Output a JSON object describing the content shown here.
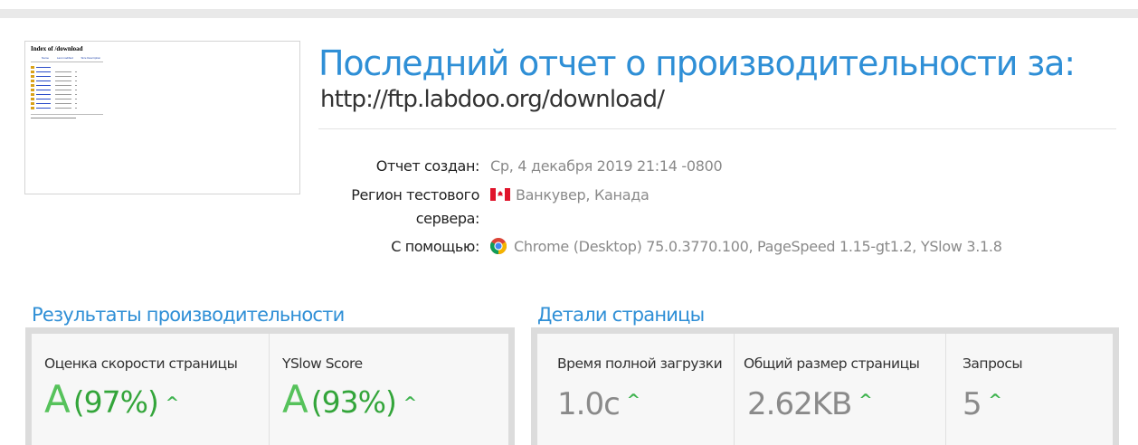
{
  "thumbnail": {
    "title": "Index of /download",
    "headers": [
      "Name",
      "Last modified",
      "Size Description"
    ]
  },
  "report": {
    "title": "Последний отчет о производительности за:",
    "url": "http://ftp.labdoo.org/download/"
  },
  "meta": {
    "created_label": "Отчет создан:",
    "created_value": "Ср, 4 декабря 2019 21:14 -0800",
    "region_label_line1": "Регион тестового",
    "region_label_line2": "сервера:",
    "region_value": "Ванкувер, Канада",
    "region_flag_icon": "canada-flag-icon",
    "using_label": "С помощью:",
    "using_value": "Chrome (Desktop) 75.0.3770.100, PageSpeed 1.15-gt1.2, YSlow 3.1.8",
    "using_icon": "chrome-icon"
  },
  "performance": {
    "section_title": "Результаты производительности",
    "pagespeed": {
      "label": "Оценка скорости страницы",
      "grade": "A",
      "percent": "(97%)"
    },
    "yslow": {
      "label": "YSlow Score",
      "grade": "A",
      "percent": "(93%)"
    }
  },
  "details": {
    "section_title": "Детали страницы",
    "load_time": {
      "label": "Время полной загрузки",
      "value": "1.0с"
    },
    "page_size": {
      "label": "Общий размер страницы",
      "value": "2.62KB"
    },
    "requests": {
      "label": "Запросы",
      "value": "5"
    }
  },
  "colors": {
    "accent": "#2f8fd6",
    "grade_green": "#56c25b",
    "caret_green": "#3fb34f",
    "muted": "#8a8a8a"
  }
}
